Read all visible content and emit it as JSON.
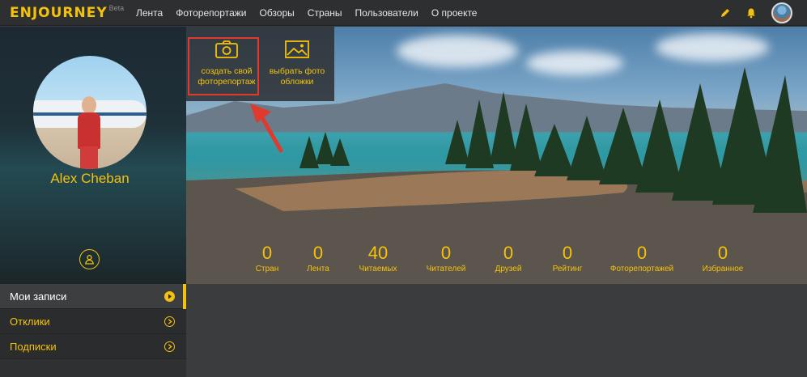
{
  "brand": {
    "logo_text": "ENJOURNEY",
    "beta_badge": "Beta",
    "accent_color": "#f4c20d"
  },
  "nav": {
    "items": [
      {
        "label": "Лента"
      },
      {
        "label": "Фоторепортажи"
      },
      {
        "label": "Обзоры"
      },
      {
        "label": "Страны"
      },
      {
        "label": "Пользователи"
      },
      {
        "label": "О проекте"
      }
    ]
  },
  "header_icons": [
    "pencil-icon",
    "bell-icon",
    "user-avatar"
  ],
  "profile": {
    "name": "Alex Cheban",
    "button_icon": "user-icon"
  },
  "sidebar_menu": {
    "items": [
      {
        "label": "Мои записи",
        "active": true
      },
      {
        "label": "Отклики",
        "active": false
      },
      {
        "label": "Подписки",
        "active": false
      }
    ]
  },
  "cover_actions": {
    "create": {
      "label": "создать свой фоторепортаж",
      "line1": "создать свой",
      "line2": "фоторепортаж",
      "icon": "camera-icon"
    },
    "cover_photo": {
      "label": "выбрать фото обложки",
      "line1": "выбрать фото",
      "line2": "обложки",
      "icon": "image-icon"
    }
  },
  "stats": [
    {
      "value": "0",
      "label": "Стран"
    },
    {
      "value": "0",
      "label": "Лента"
    },
    {
      "value": "40",
      "label": "Читаемых"
    },
    {
      "value": "0",
      "label": "Читателей"
    },
    {
      "value": "0",
      "label": "Друзей"
    },
    {
      "value": "0",
      "label": "Рейтинг"
    },
    {
      "value": "0",
      "label": "Фоторепортажей"
    },
    {
      "value": "0",
      "label": "Избранное"
    }
  ],
  "annotation": {
    "highlight_color": "#e03a2f"
  }
}
